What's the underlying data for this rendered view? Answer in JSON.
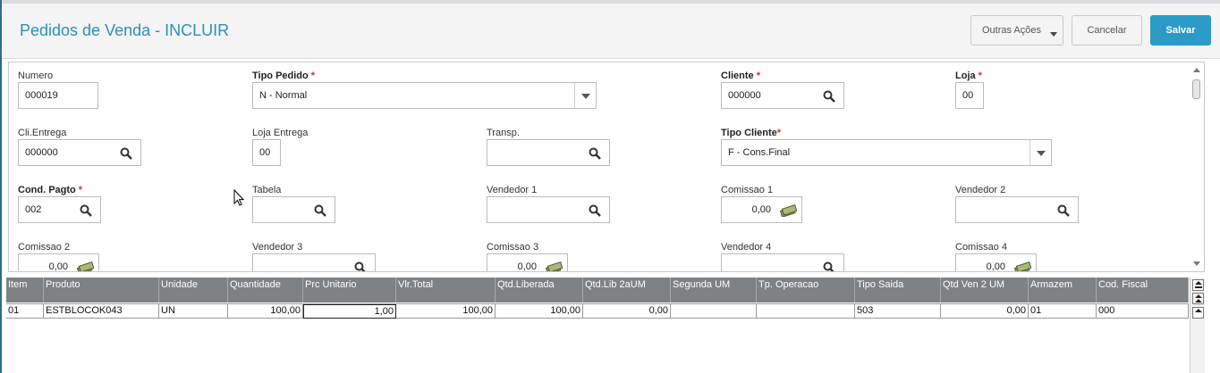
{
  "header": {
    "title": "Pedidos de Venda - INCLUIR",
    "actions": {
      "more_label": "Outras Ações",
      "cancel_label": "Cancelar",
      "save_label": "Salvar"
    }
  },
  "form": {
    "numero": {
      "label": "Numero",
      "value": "000019",
      "required": false
    },
    "tipo_pedido": {
      "label": "Tipo Pedido",
      "value": "N - Normal",
      "required": true
    },
    "cliente": {
      "label": "Cliente",
      "value": "000000",
      "required": true
    },
    "loja": {
      "label": "Loja",
      "value": "00",
      "required": true
    },
    "cli_entrega": {
      "label": "Cli.Entrega",
      "value": "000000"
    },
    "loja_entrega": {
      "label": "Loja Entrega",
      "value": "00"
    },
    "transp": {
      "label": "Transp.",
      "value": ""
    },
    "tipo_cliente": {
      "label": "Tipo Cliente",
      "value": "F - Cons.Final",
      "required": true
    },
    "cond_pagto": {
      "label": "Cond. Pagto",
      "value": "002",
      "required": true
    },
    "tabela": {
      "label": "Tabela",
      "value": ""
    },
    "vendedor1": {
      "label": "Vendedor 1",
      "value": ""
    },
    "comissao1": {
      "label": "Comissao 1",
      "value": "0,00"
    },
    "vendedor2": {
      "label": "Vendedor 2",
      "value": ""
    },
    "comissao2": {
      "label": "Comissao 2",
      "value": "0,00"
    },
    "vendedor3": {
      "label": "Vendedor 3",
      "value": ""
    },
    "comissao3": {
      "label": "Comissao 3",
      "value": "0,00"
    },
    "vendedor4": {
      "label": "Vendedor 4",
      "value": ""
    },
    "comissao4": {
      "label": "Comissao 4",
      "value": "0,00"
    },
    "required_mark": "*"
  },
  "grid": {
    "columns": [
      "Item",
      "Produto",
      "Unidade",
      "Quantidade",
      "Prc Unitario",
      "Vlr.Total",
      "Qtd.Liberada",
      "Qtd.Lib 2aUM",
      "Segunda UM",
      "Tp. Operacao",
      "Tipo Saida",
      "Qtd Ven 2 UM",
      "Armazem",
      "Cod. Fiscal"
    ],
    "rows": [
      [
        "01",
        "ESTBLOCOK043",
        "UN",
        "100,00",
        "1,00",
        "100,00",
        "100,00",
        "0,00",
        "",
        "",
        "503",
        "0,00",
        "01",
        "000"
      ]
    ]
  },
  "colors": {
    "accent": "#2a90b8",
    "save_button": "#2a9bc6",
    "required": "#d9282f",
    "grid_header": "#7e8284"
  }
}
